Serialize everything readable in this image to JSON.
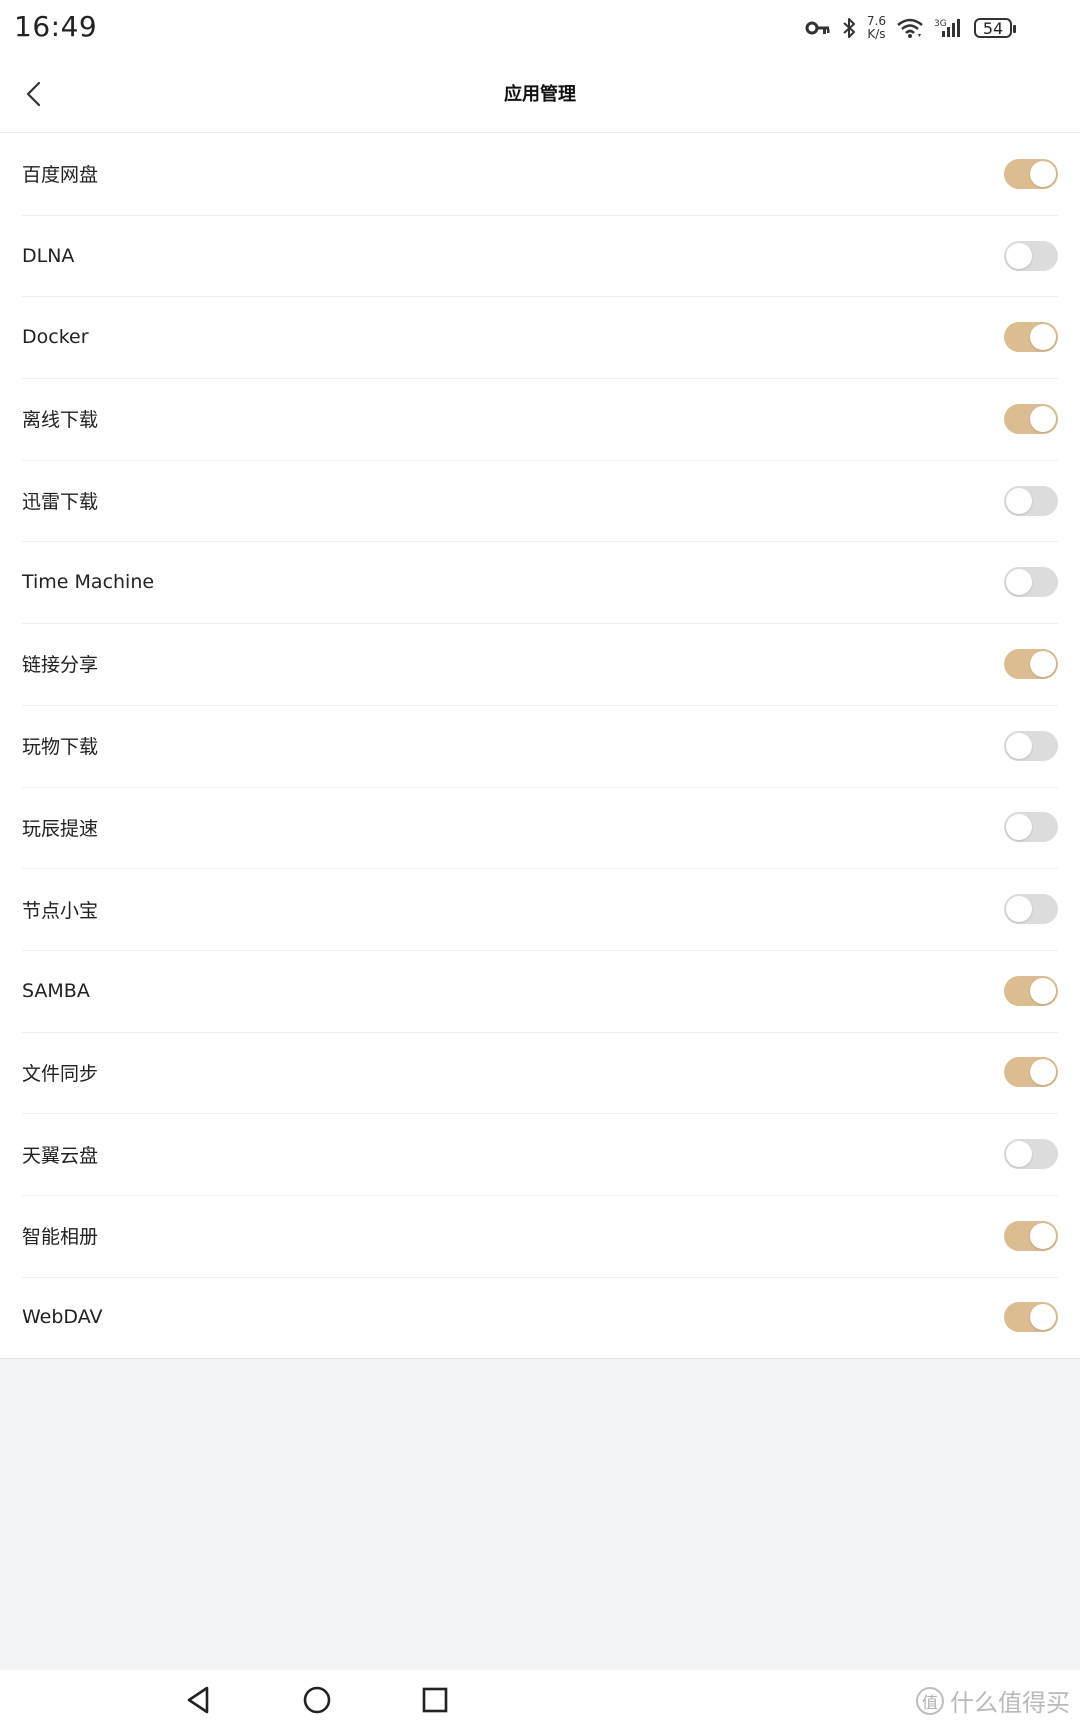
{
  "status_bar": {
    "time": "16:49",
    "net_speed_value": "7.6",
    "net_speed_unit": "K/s",
    "signal_label": "3G",
    "battery": "54",
    "icons": [
      "key-icon",
      "bluetooth-icon",
      "wifi-icon",
      "signal-icon",
      "battery-icon"
    ]
  },
  "header": {
    "title": "应用管理",
    "back_icon": "chevron-left-icon"
  },
  "apps": [
    {
      "label": "百度网盘",
      "enabled": true
    },
    {
      "label": "DLNA",
      "enabled": false
    },
    {
      "label": "Docker",
      "enabled": true
    },
    {
      "label": "离线下载",
      "enabled": true
    },
    {
      "label": "迅雷下载",
      "enabled": false
    },
    {
      "label": "Time Machine",
      "enabled": false
    },
    {
      "label": "链接分享",
      "enabled": true
    },
    {
      "label": "玩物下载",
      "enabled": false
    },
    {
      "label": "玩辰提速",
      "enabled": false
    },
    {
      "label": "节点小宝",
      "enabled": false
    },
    {
      "label": "SAMBA",
      "enabled": true
    },
    {
      "label": "文件同步",
      "enabled": true
    },
    {
      "label": "天翼云盘",
      "enabled": false
    },
    {
      "label": "智能相册",
      "enabled": true
    },
    {
      "label": "WebDAV",
      "enabled": true
    }
  ],
  "colors": {
    "toggle_on": "#dcbd92",
    "toggle_off": "#dcdcdc",
    "background": "#f3f4f6"
  },
  "nav_bar": {
    "items": [
      "back-triangle-icon",
      "home-circle-icon",
      "recents-square-icon"
    ]
  },
  "watermark": {
    "mark": "值",
    "text": "什么值得买"
  }
}
